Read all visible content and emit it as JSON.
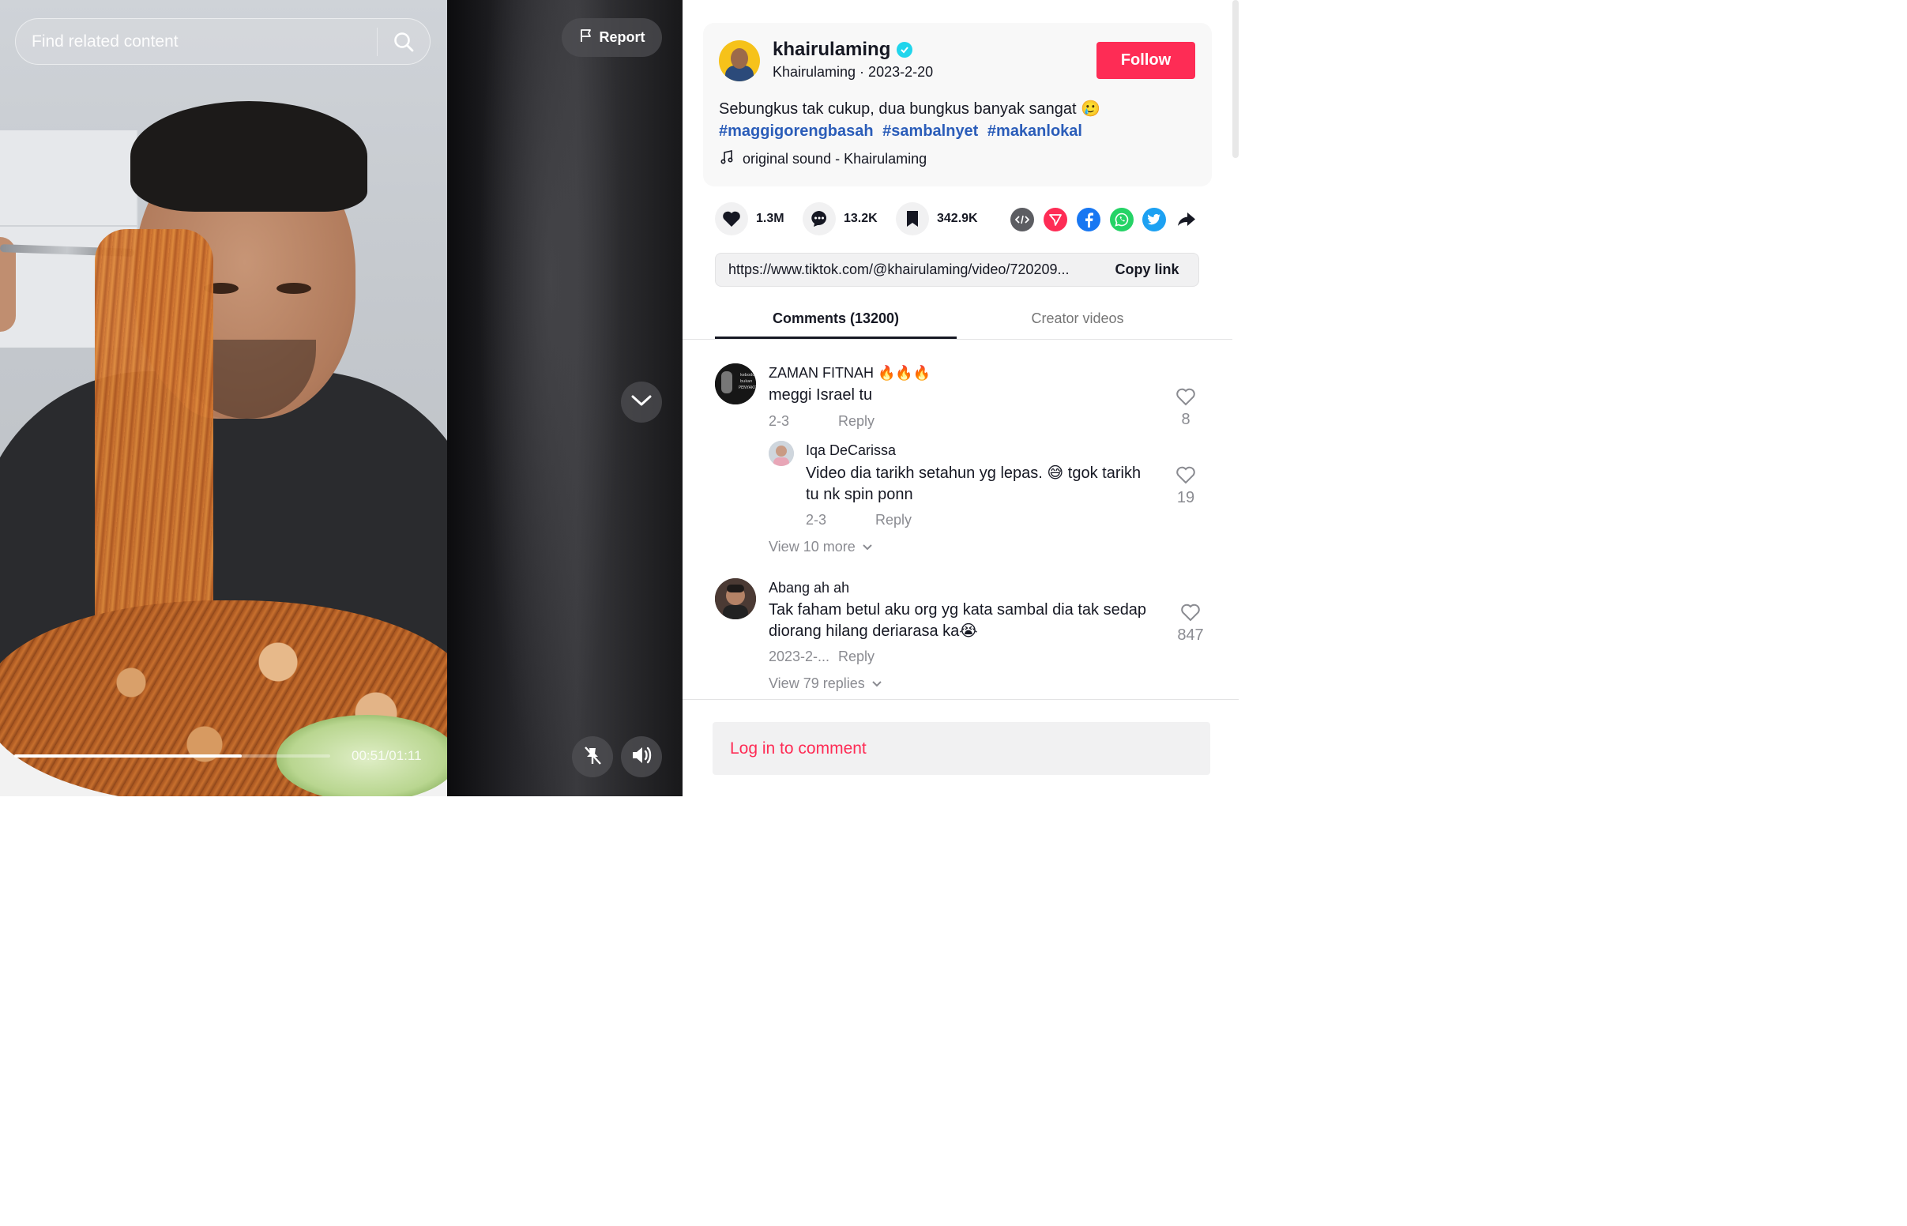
{
  "video": {
    "search_placeholder": "Find related content",
    "report_label": "Report",
    "time_display": "00:51/01:11",
    "progress_fraction": 0.72
  },
  "author": {
    "username": "khairulaming",
    "nickname_date": "Khairulaming · 2023-2-20",
    "follow_label": "Follow",
    "description": "Sebungkus tak cukup, dua bungkus banyak sangat 🥲",
    "hashtags": [
      "#maggigorengbasah",
      "#sambalnyet",
      "#makanlokal"
    ],
    "music": "original sound - Khairulaming"
  },
  "actions": {
    "likes": "1.3M",
    "comments": "13.2K",
    "saves": "342.9K"
  },
  "share_icons": [
    "embed-icon",
    "send-to-friends-icon",
    "facebook-icon",
    "whatsapp-icon",
    "twitter-icon",
    "share-arrow-icon"
  ],
  "link": {
    "url": "https://www.tiktok.com/@khairulaming/video/720209...",
    "copy_label": "Copy link"
  },
  "tabs": {
    "comments": "Comments (13200)",
    "creator_videos": "Creator videos"
  },
  "comments": [
    {
      "name": "ZAMAN FITNAH 🔥🔥🔥",
      "text": "meggi Israel tu",
      "date": "2-3",
      "reply_label": "Reply",
      "likes": "8"
    },
    {
      "name": "Iqa DeCarissa",
      "text": "Video dia tarikh setahun yg lepas. 😅 tgok tarikh tu nk spin ponn",
      "date": "2-3",
      "reply_label": "Reply",
      "likes": "19"
    },
    {
      "name": "Abang ah ah",
      "text": "Tak faham betul aku org yg kata sambal dia tak sedap diorang hilang deriarasa ka😭",
      "date": "2023-2-...",
      "reply_label": "Reply",
      "likes": "847"
    }
  ],
  "view_more_1": "View 10 more",
  "view_more_2": "View 79 replies",
  "login_label": "Log in to comment",
  "colors": {
    "accent": "#fe2c55",
    "hashtag": "#2b5db9",
    "verified": "#20d5ec"
  }
}
